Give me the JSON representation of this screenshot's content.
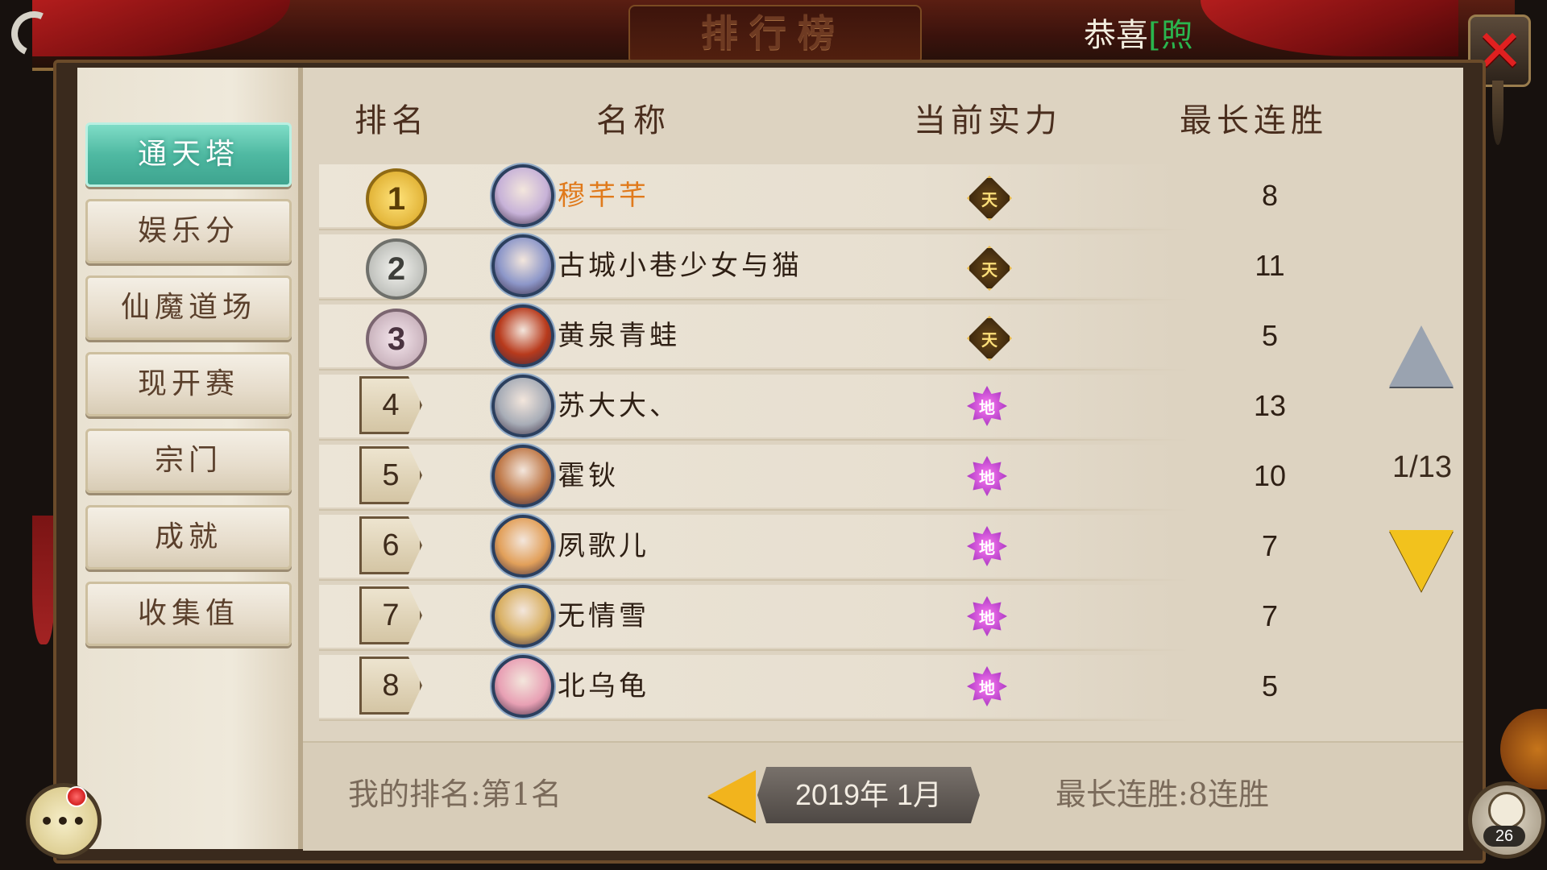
{
  "header": {
    "title": "排行榜",
    "announcement_prefix": "恭喜",
    "announcement_bracket": "[",
    "announcement_highlight": "煦"
  },
  "sidebar": {
    "items": [
      {
        "label": "通天塔",
        "active": true
      },
      {
        "label": "娱乐分",
        "active": false
      },
      {
        "label": "仙魔道场",
        "active": false
      },
      {
        "label": "现开赛",
        "active": false
      },
      {
        "label": "宗门",
        "active": false
      },
      {
        "label": "成就",
        "active": false
      },
      {
        "label": "收集值",
        "active": false
      }
    ]
  },
  "table": {
    "headers": {
      "rank": "排名",
      "name": "名称",
      "power": "当前实力",
      "streak": "最长连胜"
    },
    "rows": [
      {
        "rank": "1",
        "name": "穆芊芊",
        "power": "天",
        "streak": "8",
        "medal": "gold",
        "avatar_color": "#c7b2d8"
      },
      {
        "rank": "2",
        "name": "古城小巷少女与猫",
        "power": "天",
        "streak": "11",
        "medal": "silver",
        "avatar_color": "#8d97c9"
      },
      {
        "rank": "3",
        "name": "黄泉青蛙",
        "power": "天",
        "streak": "5",
        "medal": "bronze",
        "avatar_color": "#b83a1c"
      },
      {
        "rank": "4",
        "name": "苏大大、",
        "power": "地",
        "streak": "13",
        "medal": "tag",
        "avatar_color": "#a8adb7"
      },
      {
        "rank": "5",
        "name": "霍钬",
        "power": "地",
        "streak": "10",
        "medal": "tag",
        "avatar_color": "#c07a4a"
      },
      {
        "rank": "6",
        "name": "夙歌儿",
        "power": "地",
        "streak": "7",
        "medal": "tag",
        "avatar_color": "#e2a05a"
      },
      {
        "rank": "7",
        "name": "无情雪",
        "power": "地",
        "streak": "7",
        "medal": "tag",
        "avatar_color": "#d9b063"
      },
      {
        "rank": "8",
        "name": "北乌龟",
        "power": "地",
        "streak": "5",
        "medal": "tag",
        "avatar_color": "#e8a0b4"
      }
    ]
  },
  "pager": {
    "indicator": "1/13"
  },
  "footer": {
    "my_rank": "我的排名:第1名",
    "month": "2019年 1月",
    "my_streak": "最长连胜:8连胜"
  },
  "friends": {
    "count": "26"
  },
  "icons": {
    "close": "close-icon",
    "up": "arrow-up-icon",
    "down": "arrow-down-icon",
    "prev": "arrow-left-icon",
    "chat": "chat-icon",
    "friends": "friends-icon"
  },
  "colors": {
    "active_tab": "#4fb9a2",
    "first_place_name": "#e07a1c",
    "announce_highlight": "#2ab54e",
    "close": "#e02020"
  }
}
